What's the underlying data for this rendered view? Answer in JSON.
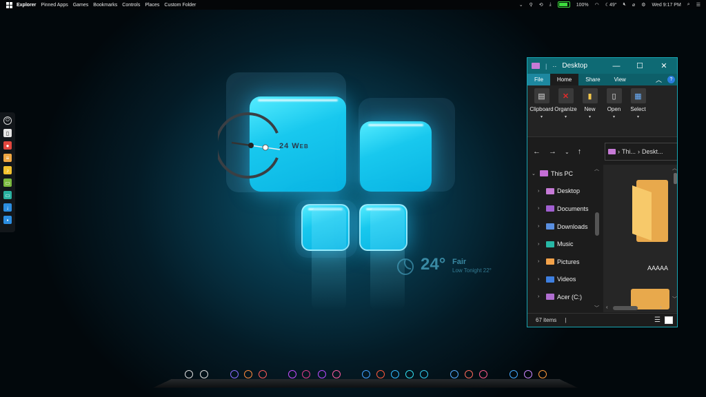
{
  "menubar": {
    "items": [
      "Explorer",
      "Pinned Apps",
      "Games",
      "Bookmarks",
      "Controls",
      "Places",
      "Custom Folder"
    ],
    "tray": {
      "battery": "100%",
      "weather_temp": "49°",
      "clock": "Wed 9:17 PM"
    }
  },
  "launcher": {
    "icons": [
      "power-icon",
      "trash-icon",
      "record-icon",
      "notes-icon",
      "music-icon",
      "chat-icon",
      "window-icon",
      "download-icon",
      "store-icon"
    ]
  },
  "clock_widget": {
    "label": "24 Web"
  },
  "weather_widget": {
    "temp": "24°",
    "condition": "Fair",
    "low": "Low Tonight 22°"
  },
  "explorer": {
    "title": "Desktop",
    "tabs": [
      "File",
      "Home",
      "Share",
      "View"
    ],
    "ribbon": [
      "Clipboard",
      "Organize",
      "New",
      "Open",
      "Select"
    ],
    "breadcrumb": [
      "Thi...",
      "Deskt..."
    ],
    "nav": [
      {
        "label": "This PC",
        "color": "#c56ed6"
      },
      {
        "label": "Desktop",
        "color": "#c67ad6"
      },
      {
        "label": "Documents",
        "color": "#a15fd1"
      },
      {
        "label": "Downloads",
        "color": "#5a8fe0"
      },
      {
        "label": "Music",
        "color": "#27b8a6"
      },
      {
        "label": "Pictures",
        "color": "#f3a24a"
      },
      {
        "label": "Videos",
        "color": "#3e7fe0"
      },
      {
        "label": "Acer (C:)",
        "color": "#b06ed0"
      }
    ],
    "folder_name": "AAAAA",
    "status": "67 items"
  },
  "dock": {
    "icons": [
      "finder-icon",
      "alien-icon",
      "app-icon",
      "chrome-like-icon",
      "trash-icon",
      "firefox-icon",
      "debian-icon",
      "brush-icon",
      "pen-icon",
      "vs-icon",
      "artix-icon",
      "unity-icon",
      "box-icon",
      "music-icon",
      "at-icon",
      "vlc-icon",
      "settings-icon",
      "chrome-icon",
      "compass-icon",
      "media-icon"
    ]
  }
}
